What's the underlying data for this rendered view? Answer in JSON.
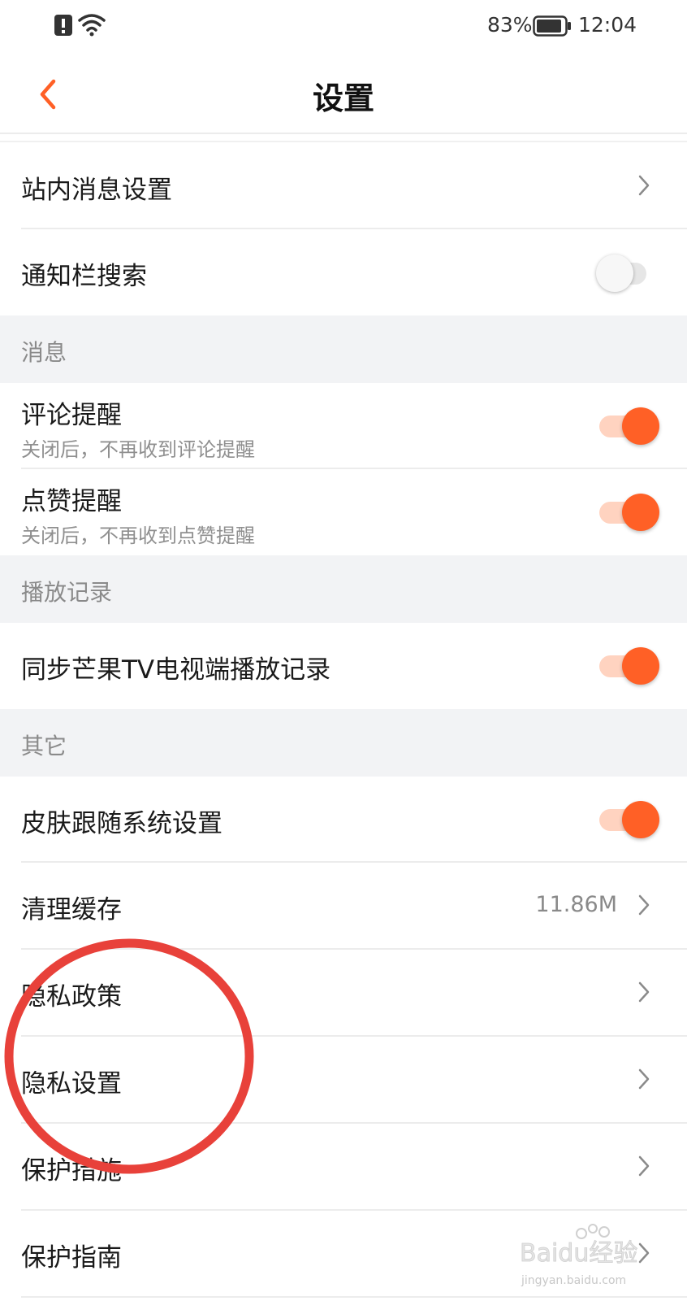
{
  "status_bar": {
    "battery": "83%",
    "time": "12:04"
  },
  "header": {
    "title": "设置"
  },
  "rows_top": [
    {
      "title": "站内消息设置"
    },
    {
      "title": "通知栏搜索",
      "toggle": "off"
    }
  ],
  "sections": {
    "messages": {
      "title": "消息",
      "items": [
        {
          "title": "评论提醒",
          "subtitle": "关闭后，不再收到评论提醒",
          "toggle": "on"
        },
        {
          "title": "点赞提醒",
          "subtitle": "关闭后，不再收到点赞提醒",
          "toggle": "on"
        }
      ]
    },
    "history": {
      "title": "播放记录",
      "items": [
        {
          "title": "同步芒果TV电视端播放记录",
          "toggle": "on"
        }
      ]
    },
    "other": {
      "title": "其它",
      "items": [
        {
          "title": "皮肤跟随系统设置",
          "toggle": "on"
        },
        {
          "title": "清理缓存",
          "value": "11.86M"
        },
        {
          "title": "隐私政策"
        },
        {
          "title": "隐私设置"
        },
        {
          "title": "保护措施"
        },
        {
          "title": "保护指南"
        }
      ]
    }
  },
  "watermark": {
    "text": "Baidu经验",
    "url": "jingyan.baidu.com"
  },
  "colors": {
    "accent": "#ff6026",
    "annotation": "#e8413a",
    "section_bg": "#f2f3f5"
  }
}
